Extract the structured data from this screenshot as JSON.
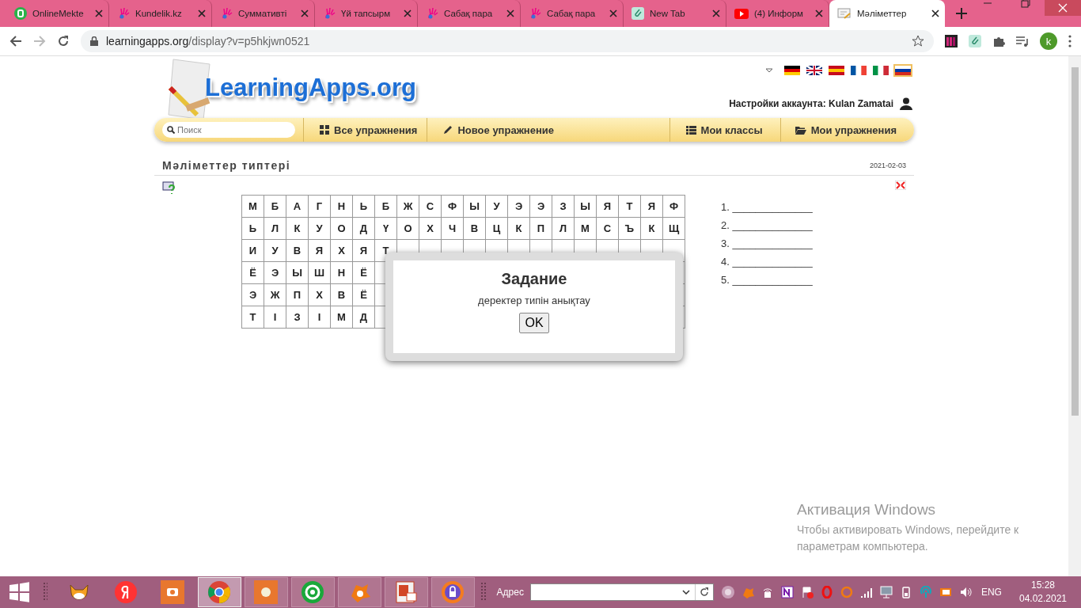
{
  "browser": {
    "tabs": [
      {
        "title": "OnlineMekte",
        "kind": "b",
        "selected": false
      },
      {
        "title": "Kundelik.kz",
        "kind": "hand",
        "selected": false
      },
      {
        "title": "Суммативті",
        "kind": "hand",
        "selected": false
      },
      {
        "title": "Үй тапсырм",
        "kind": "hand",
        "selected": false
      },
      {
        "title": "Сабақ пара",
        "kind": "hand",
        "selected": false
      },
      {
        "title": "Сабақ пара",
        "kind": "hand",
        "selected": false
      },
      {
        "title": "New Tab",
        "kind": "clip",
        "selected": false
      },
      {
        "title": "(4) Информ",
        "kind": "youtube",
        "selected": false
      },
      {
        "title": "Мәліметтер",
        "kind": "page",
        "selected": true
      }
    ],
    "url_host": "learningapps.org",
    "url_path": "/display?v=p5hkjwn0521",
    "profile_initial": "k"
  },
  "site": {
    "logo": "LearningApps.org",
    "account": "Настройки аккаунта: Kulan Zamatai",
    "languages": [
      {
        "kind": "de",
        "selected": false
      },
      {
        "kind": "gb",
        "selected": false
      },
      {
        "kind": "es",
        "selected": false
      },
      {
        "kind": "fr",
        "selected": false
      },
      {
        "kind": "it",
        "selected": false
      },
      {
        "kind": "ru",
        "selected": true
      }
    ],
    "search": {
      "placeholder": "Поиск"
    },
    "nav": [
      {
        "label": "Все упражнения"
      },
      {
        "label": "Новое упражнение"
      },
      {
        "label": "Мои классы"
      },
      {
        "label": "Мои упражнения"
      }
    ]
  },
  "exercise": {
    "title": "Мәліметтер типтері",
    "date": "2021-02-03",
    "grid": [
      [
        "М",
        "Б",
        "А",
        "Г",
        "Н",
        "Ь",
        "Б",
        "Ж",
        "С",
        "Ф",
        "Ы",
        "У",
        "Э",
        "Э",
        "З",
        "Ы",
        "Я",
        "Т",
        "Я",
        "Ф"
      ],
      [
        "Ь",
        "Л",
        "К",
        "У",
        "О",
        "Д",
        "Ү",
        "О",
        "Х",
        "Ч",
        "В",
        "Ц",
        "К",
        "П",
        "Л",
        "М",
        "С",
        "Ъ",
        "К",
        "Щ"
      ],
      [
        "И",
        "У",
        "В",
        "Я",
        "Х",
        "Я",
        "Т"
      ],
      [
        "Ё",
        "Э",
        "Ы",
        "Ш",
        "Н",
        "Ё"
      ],
      [
        "Э",
        "Ж",
        "П",
        "Х",
        "В",
        "Ё"
      ],
      [
        "Т",
        "І",
        "З",
        "І",
        "М",
        "Д"
      ]
    ],
    "answers": [
      "1. ______________",
      "2. ______________",
      "3. ______________",
      "4. ______________",
      "5. ______________"
    ],
    "dialog": {
      "title": "Задание",
      "text": "деректер типін анықтау",
      "button": "OK"
    }
  },
  "watermark": {
    "title": "Активация Windows",
    "text": "Чтобы активировать Windows, перейдите к параметрам компьютера."
  },
  "taskbar": {
    "apps": [
      {
        "kind": "cat",
        "active": false
      },
      {
        "kind": "yandex",
        "active": false
      },
      {
        "kind": "camera",
        "active": false
      },
      {
        "kind": "chrome",
        "active": true
      },
      {
        "kind": "record",
        "active": false
      },
      {
        "kind": "mail",
        "active": false
      },
      {
        "kind": "avast",
        "active": false
      },
      {
        "kind": "powerpoint",
        "active": false
      },
      {
        "kind": "vpn",
        "active": false
      }
    ],
    "address_label": "Адрес",
    "language": "ENG",
    "time": "15:28",
    "date": "04.02.2021"
  }
}
